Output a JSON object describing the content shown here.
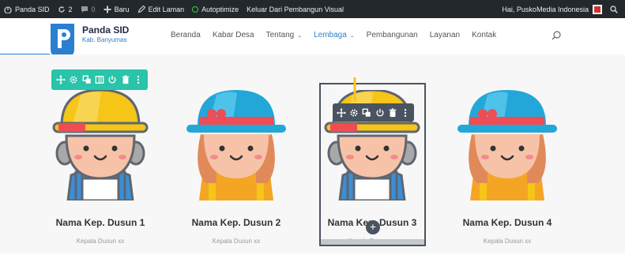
{
  "adminbar": {
    "site_name": "Panda SID",
    "updates_count": "2",
    "comments_count": "0",
    "new_label": "Baru",
    "edit_label": "Edit Laman",
    "autoptimize_label": "Autoptimize",
    "exit_builder_label": "Keluar Dari Pembangun Visual",
    "greeting": "Hai, PuskoMedia Indonesia"
  },
  "brand": {
    "title": "Panda SID",
    "subtitle": "Kab. Banyumas"
  },
  "nav": [
    {
      "label": "Beranda",
      "dropdown": false
    },
    {
      "label": "Kabar Desa",
      "dropdown": false
    },
    {
      "label": "Tentang",
      "dropdown": true
    },
    {
      "label": "Lembaga",
      "dropdown": true,
      "active": true
    },
    {
      "label": "Pembangunan",
      "dropdown": false
    },
    {
      "label": "Layanan",
      "dropdown": false
    },
    {
      "label": "Kontak",
      "dropdown": false
    }
  ],
  "cards": [
    {
      "name": "Nama Kep. Dusun 1",
      "role": "Kepala Dusun xx",
      "avatar": "boy"
    },
    {
      "name": "Nama Kep. Dusun 2",
      "role": "Kepala Dusun xx",
      "avatar": "girl"
    },
    {
      "name": "Nama Kep. Dusun 3",
      "role": "Kepala Dusun xx",
      "avatar": "boy"
    },
    {
      "name": "Nama Kep. Dusun 4",
      "role": "Kepala Dusun xx",
      "avatar": "girl"
    }
  ],
  "row_toolbar_icons": [
    "move-icon",
    "settings-icon",
    "duplicate-icon",
    "columns-icon",
    "power-icon",
    "trash-icon",
    "more-icon"
  ],
  "module_toolbar_icons": [
    "move-icon",
    "settings-icon",
    "duplicate-icon",
    "power-icon",
    "trash-icon",
    "more-icon"
  ],
  "add_button": "+",
  "colors": {
    "adminbar_bg": "#23282d",
    "brand_blue": "#2a7fd0",
    "row_toolbar": "#29c4a9",
    "module_toolbar": "#4a5360",
    "arrow": "#f5c518"
  }
}
